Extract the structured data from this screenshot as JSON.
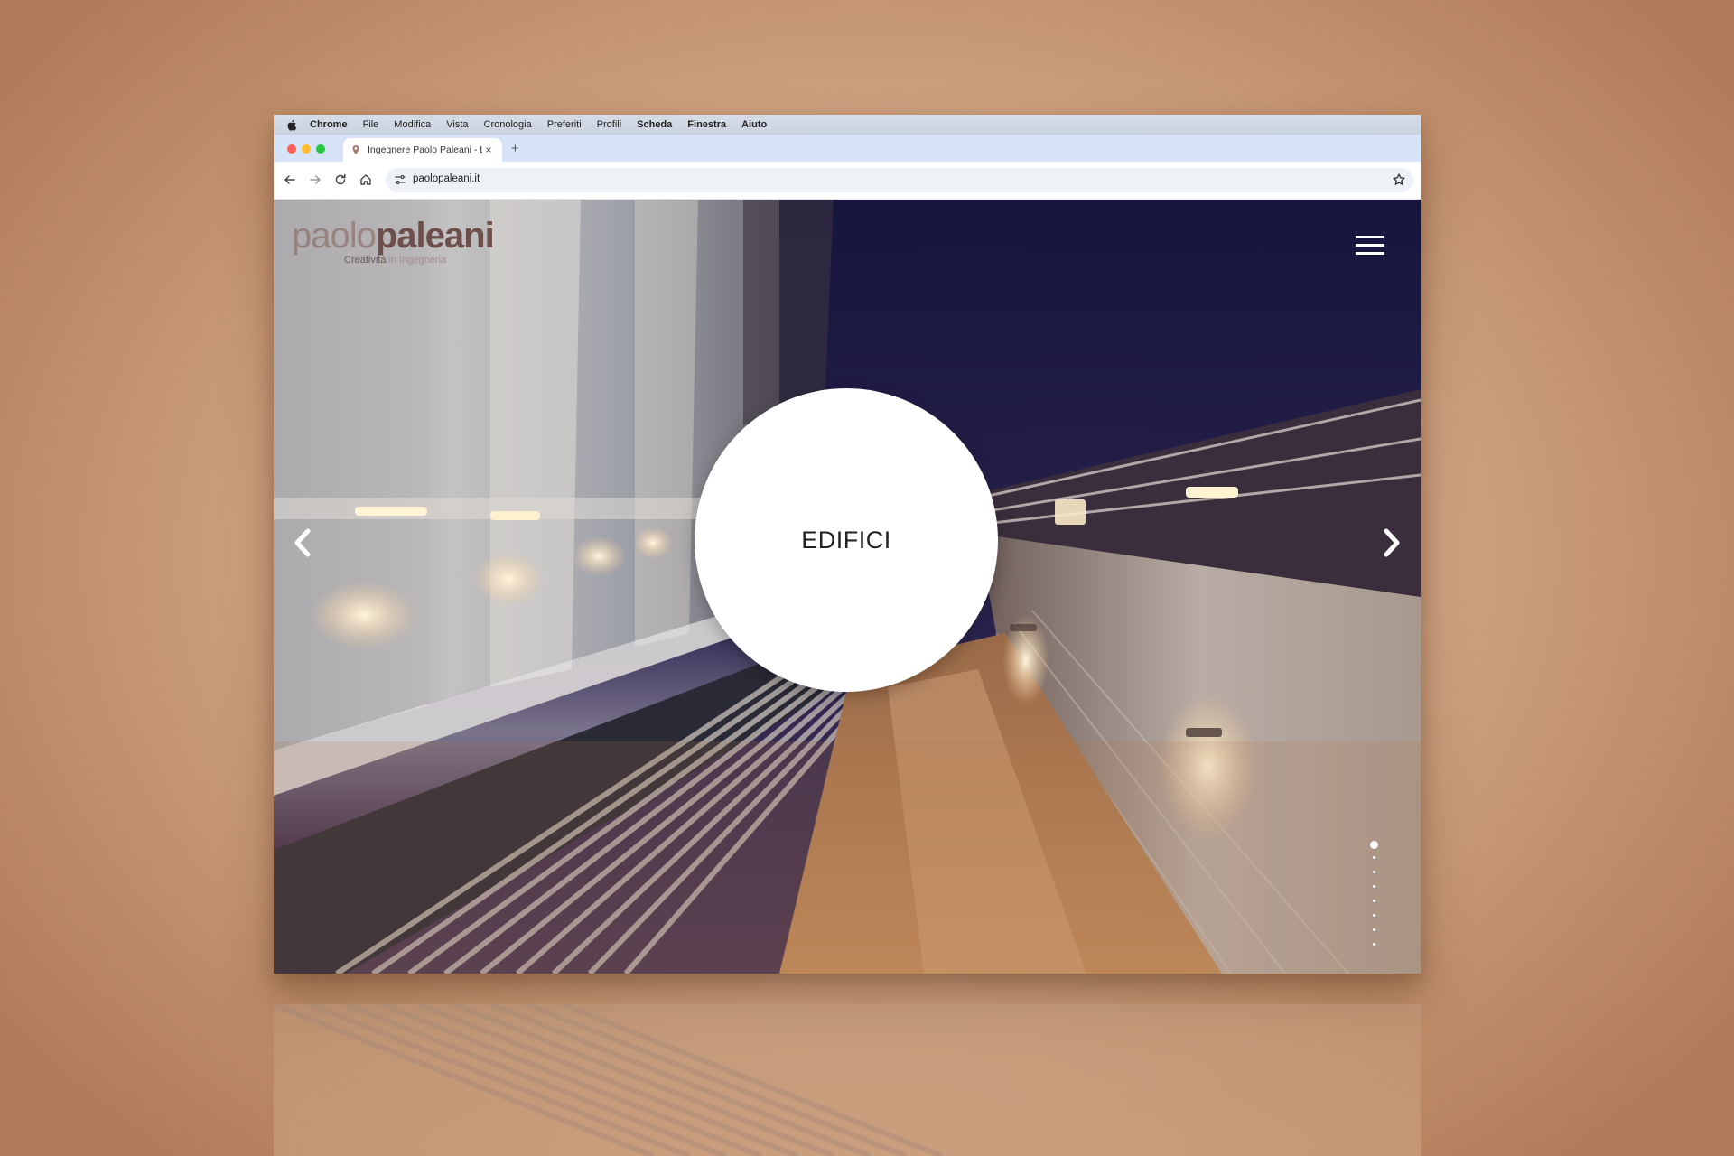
{
  "menubar": {
    "items": [
      "Chrome",
      "File",
      "Modifica",
      "Vista",
      "Cronologia",
      "Preferiti",
      "Profili",
      "Scheda",
      "Finestra",
      "Aiuto"
    ],
    "bold_items": [
      "Chrome",
      "Scheda",
      "Finestra",
      "Aiuto"
    ]
  },
  "tab": {
    "title": "Ingegnere Paolo Paleani - Lo",
    "close_glyph": "×",
    "new_tab_glyph": "+"
  },
  "address_bar": {
    "url": "paolopaleani.it"
  },
  "site": {
    "logo": {
      "word_light": "paolo",
      "word_bold": "paleani",
      "tagline_dark": "Creatività",
      "tagline_light": "in Ingegneria"
    },
    "slide": {
      "label": "EDIFICI",
      "total_slides": 8,
      "active_index": 0
    },
    "icons": {
      "menu": "hamburger-icon",
      "prev": "chevron-left-icon",
      "next": "chevron-right-icon"
    }
  },
  "colors": {
    "tabstrip": "#d7e4f7",
    "omnibox": "#eef1f6",
    "sky": "#1c1b45",
    "logo_dark": "#6e4f4b",
    "page_backdrop": "#c89a78",
    "traffic_red": "#ff5f57",
    "traffic_yellow": "#febc2e",
    "traffic_green": "#28c840"
  }
}
